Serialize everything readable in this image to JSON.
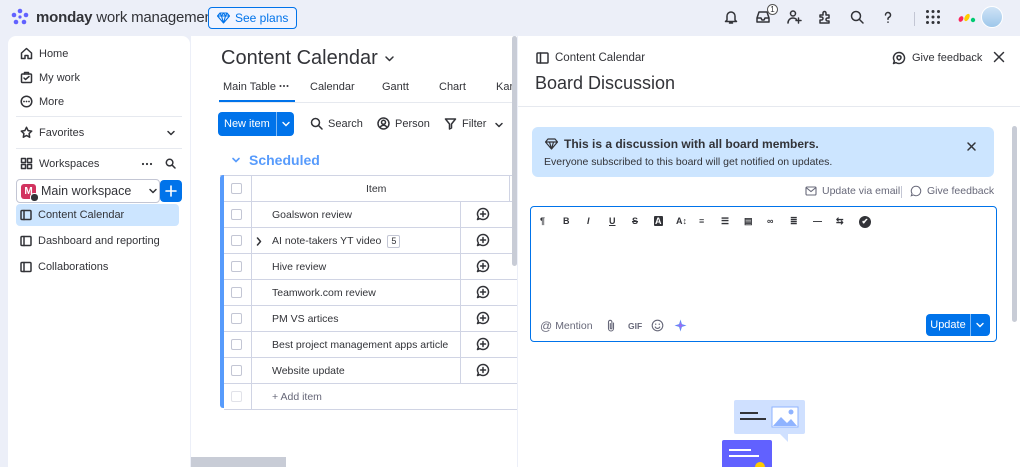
{
  "app": {
    "brand_bold": "monday",
    "brand_rest": " work management",
    "see_plans": "See plans",
    "notification_count": "1",
    "colors": {
      "accent": "#0073ea",
      "group": "#579bfc",
      "panel_info": "#cce5ff",
      "workspace": "#d2335f"
    }
  },
  "sidebar": {
    "home": "Home",
    "my_work": "My work",
    "more": "More",
    "favorites": "Favorites",
    "workspaces": "Workspaces",
    "workspace_initial": "M",
    "workspace_name": "Main workspace",
    "items": [
      {
        "label": "Content Calendar"
      },
      {
        "label": "Dashboard and reporting"
      },
      {
        "label": "Collaborations"
      }
    ]
  },
  "board": {
    "title": "Content Calendar",
    "tabs": [
      "Main Table",
      "Calendar",
      "Gantt",
      "Chart",
      "Kan"
    ],
    "new_item": "New item",
    "search": "Search",
    "person": "Person",
    "filter": "Filter",
    "group_title": "Scheduled",
    "column_item": "Item",
    "rows": [
      {
        "name": "Goalswon review"
      },
      {
        "name": "AI note-takers YT video",
        "subitems": "5"
      },
      {
        "name": "Hive review"
      },
      {
        "name": "Teamwork.com review"
      },
      {
        "name": "PM VS artices"
      },
      {
        "name": "Best project management apps article"
      },
      {
        "name": "Website update"
      }
    ],
    "add_item": "+ Add item"
  },
  "panel": {
    "crumb": "Content Calendar",
    "title": "Board Discussion",
    "give_feedback": "Give feedback",
    "info_title": "This is a discussion with all board members.",
    "info_sub": "Everyone subscribed to this board will get notified on updates.",
    "update_via_email": "Update via email",
    "give_feedback_2": "Give feedback",
    "toolbar": [
      "¶",
      "B",
      "I",
      "U",
      "S",
      "A",
      "A↕",
      "≡",
      "☰",
      "▤",
      "∞",
      "≣",
      "—",
      "⇆",
      "✔"
    ],
    "mention": "Mention",
    "gif": "GIF",
    "update": "Update"
  }
}
